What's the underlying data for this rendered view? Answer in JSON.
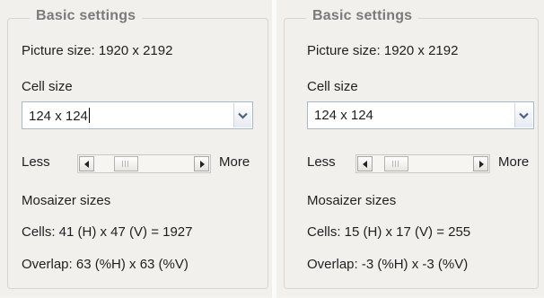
{
  "panels": [
    {
      "group_title": "Basic settings",
      "picture_size": "Picture size: 1920 x 2192",
      "cell_size_label": "Cell size",
      "cell_size_value": "124 x 124",
      "less_label": "Less",
      "more_label": "More",
      "slider_level": 0.25,
      "mosaizer_label": "Mosaizer sizes",
      "cells_text": "Cells: 41 (H) x 47 (V) = 1927",
      "overlap_text": "Overlap: 63 (%H) x 63 (%V)"
    },
    {
      "group_title": "Basic settings",
      "picture_size": "Picture size: 1920 x 2192",
      "cell_size_label": "Cell size",
      "cell_size_value": "124 x 124",
      "less_label": "Less",
      "more_label": "More",
      "slider_level": 0.15,
      "mosaizer_label": "Mosaizer sizes",
      "cells_text": "Cells: 15 (H) x 17 (V) = 255",
      "overlap_text": "Overlap: -3 (%H) x -3 (%V)"
    }
  ]
}
